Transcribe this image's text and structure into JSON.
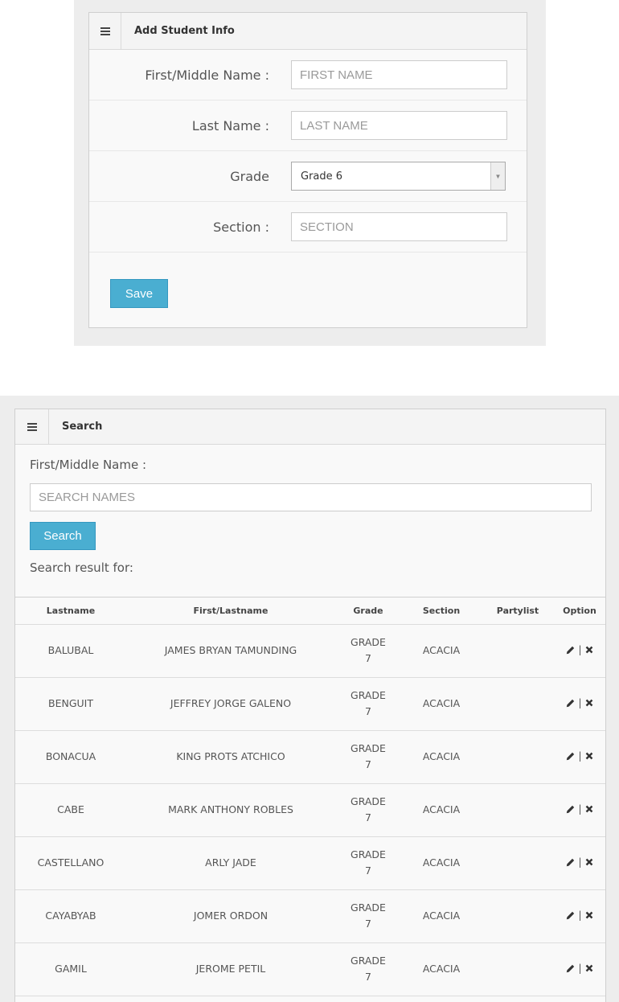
{
  "add_panel": {
    "title": "Add Student Info",
    "first_label": "First/Middle Name :",
    "first_placeholder": "FIRST NAME",
    "last_label": "Last Name :",
    "last_placeholder": "LAST NAME",
    "grade_label": "Grade",
    "grade_selected": "Grade 6",
    "section_label": "Section :",
    "section_placeholder": "SECTION",
    "save_label": "Save"
  },
  "search_panel": {
    "title": "Search",
    "name_label": "First/Middle Name :",
    "search_placeholder": "SEARCH NAMES",
    "search_label": "Search",
    "result_label": "Search result for:"
  },
  "table": {
    "headers": [
      "Lastname",
      "First/Lastname",
      "Grade",
      "Section",
      "Partylist",
      "Option"
    ],
    "rows": [
      {
        "lastname": "BALUBAL",
        "name": "JAMES BRYAN TAMUNDING",
        "grade": "GRADE 7",
        "section": "ACACIA",
        "partylist": ""
      },
      {
        "lastname": "BENGUIT",
        "name": "JEFFREY JORGE GALENO",
        "grade": "GRADE 7",
        "section": "ACACIA",
        "partylist": ""
      },
      {
        "lastname": "BONACUA",
        "name": "KING PROTS ATCHICO",
        "grade": "GRADE 7",
        "section": "ACACIA",
        "partylist": ""
      },
      {
        "lastname": "CABE",
        "name": "MARK ANTHONY ROBLES",
        "grade": "GRADE 7",
        "section": "ACACIA",
        "partylist": ""
      },
      {
        "lastname": "CASTELLANO",
        "name": "ARLY JADE",
        "grade": "GRADE 7",
        "section": "ACACIA",
        "partylist": ""
      },
      {
        "lastname": "CAYABYAB",
        "name": "JOMER ORDON",
        "grade": "GRADE 7",
        "section": "ACACIA",
        "partylist": ""
      },
      {
        "lastname": "GAMIL",
        "name": "JEROME PETIL",
        "grade": "GRADE 7",
        "section": "ACACIA",
        "partylist": ""
      }
    ],
    "option_separator": "|"
  },
  "icons": {
    "header_icon": "list-icon",
    "edit_icon": "pencil-icon",
    "delete_icon": "close-icon"
  },
  "colors": {
    "button": "#4aaed1",
    "background": "#ededed"
  }
}
